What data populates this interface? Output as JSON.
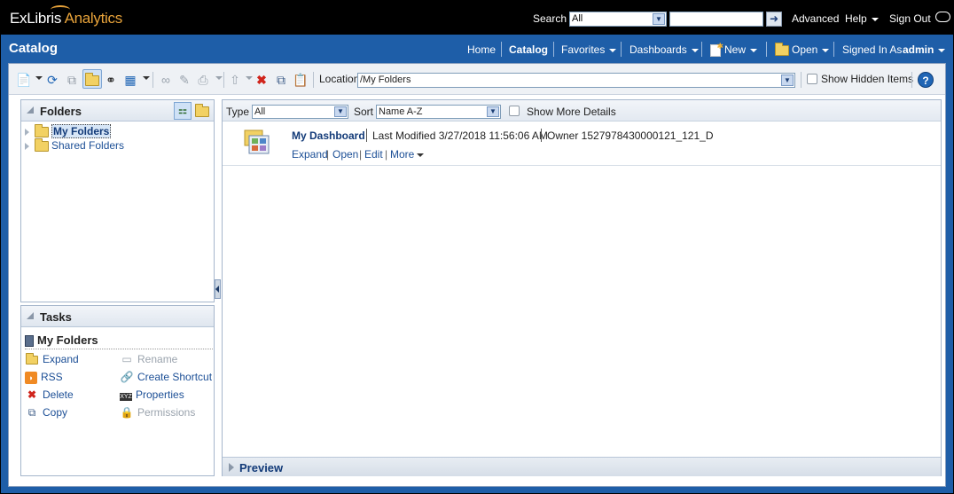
{
  "brand": {
    "logo_main": "ExLibris",
    "logo_sub": "Analytics"
  },
  "topbar": {
    "search_label": "Search",
    "search_scope": "All",
    "search_value": "",
    "advanced": "Advanced",
    "help": "Help",
    "sign_out": "Sign Out"
  },
  "header": {
    "title": "Catalog",
    "nav": {
      "home": "Home",
      "catalog": "Catalog",
      "favorites": "Favorites",
      "dashboards": "Dashboards",
      "new": "New",
      "open": "Open",
      "signed_in_as": "Signed In As",
      "user": "admin"
    }
  },
  "toolbar": {
    "location_label": "Location",
    "location_value": "/My Folders",
    "show_hidden": "Show Hidden Items",
    "help_glyph": "?"
  },
  "folders_pane": {
    "title": "Folders",
    "items": [
      {
        "label": "My Folders",
        "selected": true
      },
      {
        "label": "Shared Folders",
        "selected": false
      }
    ]
  },
  "tasks_pane": {
    "title": "Tasks",
    "context": "My Folders",
    "tasks": {
      "expand": "Expand",
      "rss": "RSS",
      "delete": "Delete",
      "copy": "Copy",
      "rename": "Rename",
      "create_shortcut": "Create Shortcut",
      "properties": "Properties",
      "permissions": "Permissions"
    }
  },
  "filters": {
    "type_label": "Type",
    "type_value": "All",
    "sort_label": "Sort",
    "sort_value": "Name A-Z",
    "more_details": "Show More Details"
  },
  "items": [
    {
      "name": "My Dashboard",
      "last_modified": "Last Modified 3/27/2018 11:56:06 AM",
      "owner": "Owner 1527978430000121_121_D",
      "actions": {
        "expand": "Expand",
        "open": "Open",
        "edit": "Edit",
        "more": "More"
      },
      "pipe": "|"
    }
  ],
  "preview": {
    "title": "Preview"
  },
  "colors": {
    "header_blue": "#1e5ea8",
    "link_blue": "#1c4f96",
    "logo_accent": "#e8a33a"
  }
}
